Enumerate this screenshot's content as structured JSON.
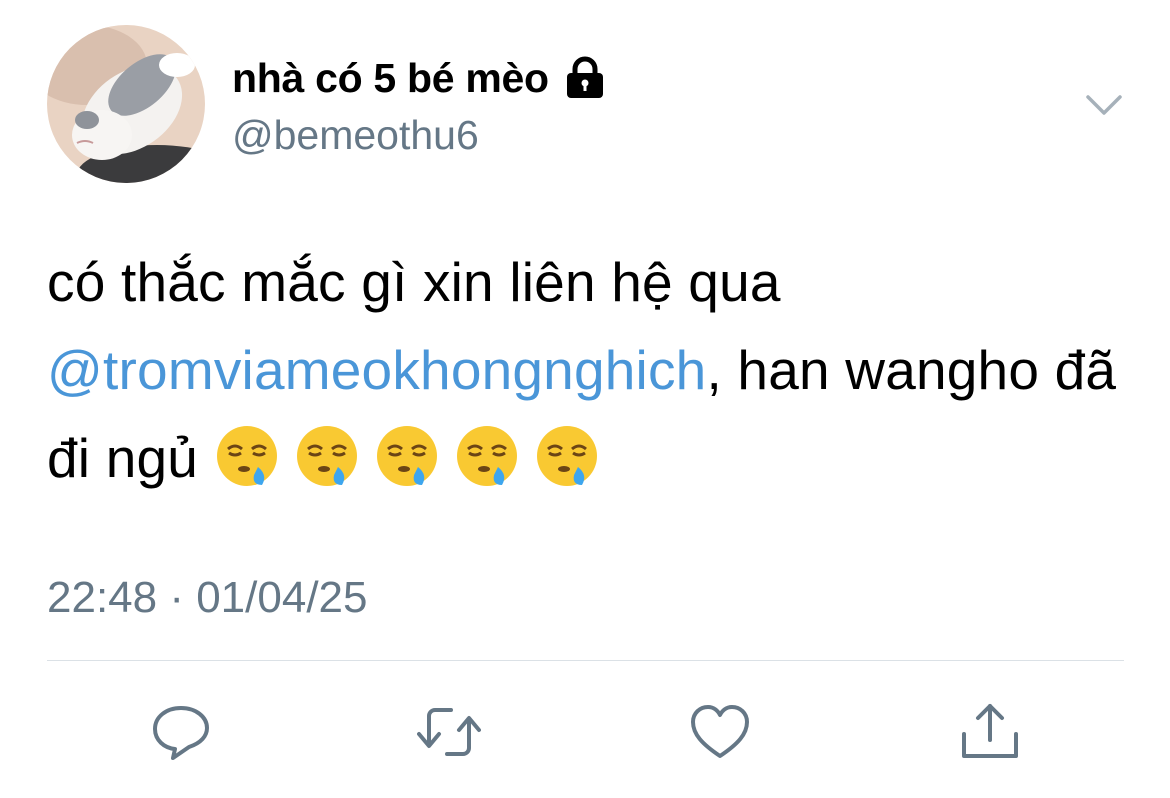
{
  "author": {
    "display_name": "nhà có 5 bé mèo",
    "handle": "@bemeothu6",
    "protected_icon": "lock-icon",
    "avatar": "cat-avatar"
  },
  "header": {
    "menu_icon": "chevron-down-icon"
  },
  "tweet": {
    "text_part_1": "có thắc mắc gì xin liên hệ qua ",
    "mention": "@tromviameokhongnghich",
    "text_part_2": ", han wangho đã đi ngủ ",
    "emoji": [
      "sleepy-face-emoji",
      "sleepy-face-emoji",
      "sleepy-face-emoji",
      "sleepy-face-emoji",
      "sleepy-face-emoji"
    ],
    "timestamp": "22:48 · 01/04/25"
  },
  "actions": [
    {
      "name": "reply-button",
      "icon": "reply-icon"
    },
    {
      "name": "retweet-button",
      "icon": "retweet-icon"
    },
    {
      "name": "like-button",
      "icon": "heart-icon"
    },
    {
      "name": "share-button",
      "icon": "share-icon"
    }
  ],
  "colors": {
    "link": "#4a96d8",
    "secondary_text": "#657786",
    "divider": "#dbe1e6",
    "icon_gray": "#657786"
  }
}
